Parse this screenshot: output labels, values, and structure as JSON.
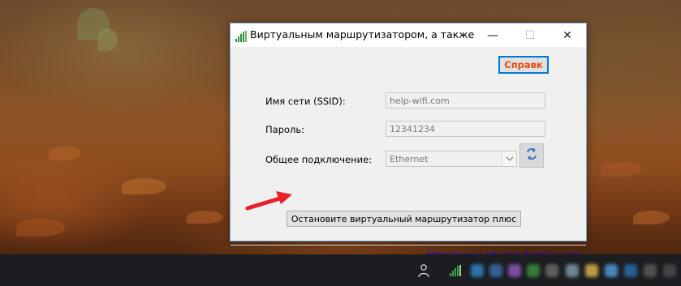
{
  "window": {
    "title": "Виртуальным маршрутизатором, а также",
    "controls": {
      "minimize": "—",
      "maximize": "☐",
      "close": "✕"
    }
  },
  "form": {
    "help_label": "Справк",
    "ssid": {
      "label": "Имя сети (SSID):",
      "value": "help-wifi.com"
    },
    "password": {
      "label": "Пароль:",
      "value": "12341234"
    },
    "connection": {
      "label": "Общее подключение:",
      "value": "Ethernet"
    },
    "stop_label": "Остановите виртуальный маршрутизатор плюс",
    "link": "http://www.virtualrouterplus.com"
  },
  "colors": {
    "help_text": "#e84a0c",
    "help_border": "#0078d7",
    "arrow": "#e8202a",
    "taskbar": "#1b1d20"
  },
  "icons": {
    "app": "wifi-bars-icon",
    "refresh": "refresh-icon",
    "tray_person": "person-icon",
    "tray_wifi": "wifi-bars-icon"
  }
}
